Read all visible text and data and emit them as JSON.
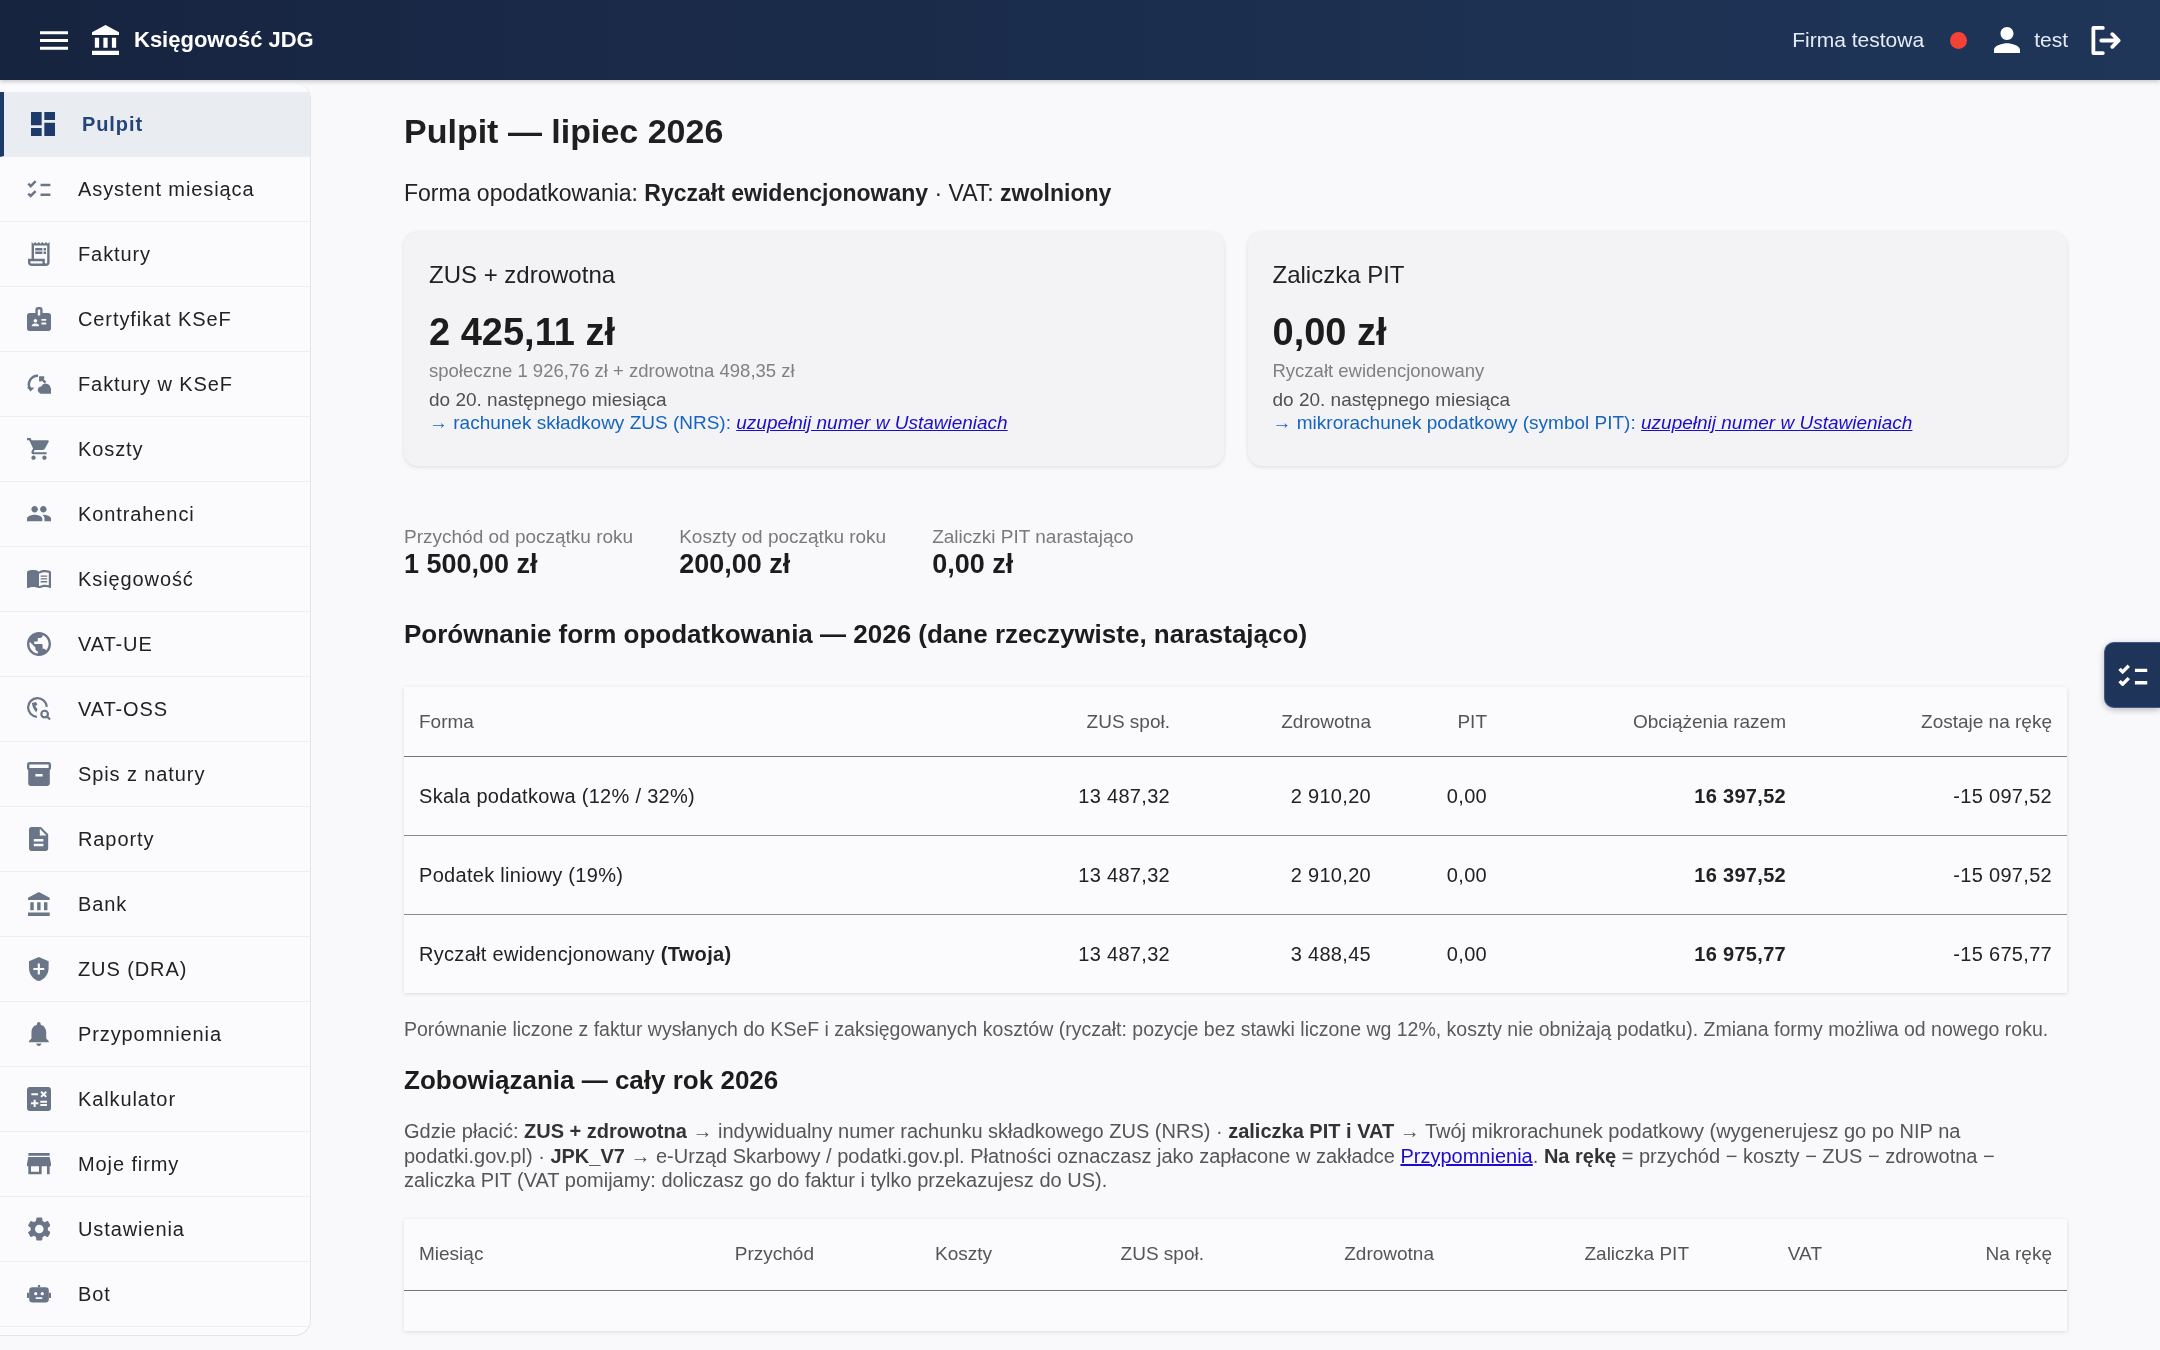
{
  "app_bar": {
    "title": "Księgowość JDG",
    "company": "Firma testowa",
    "user": "test"
  },
  "sidebar": {
    "items": [
      {
        "label": "Pulpit",
        "selected": true
      },
      {
        "label": "Asystent miesiąca",
        "selected": false
      },
      {
        "label": "Faktury",
        "selected": false
      },
      {
        "label": "Certyfikat KSeF",
        "selected": false
      },
      {
        "label": "Faktury w KSeF",
        "selected": false
      },
      {
        "label": "Koszty",
        "selected": false
      },
      {
        "label": "Kontrahenci",
        "selected": false
      },
      {
        "label": "Księgowość",
        "selected": false
      },
      {
        "label": "VAT-UE",
        "selected": false
      },
      {
        "label": "VAT-OSS",
        "selected": false
      },
      {
        "label": "Spis z natury",
        "selected": false
      },
      {
        "label": "Raporty",
        "selected": false
      },
      {
        "label": "Bank",
        "selected": false
      },
      {
        "label": "ZUS (DRA)",
        "selected": false
      },
      {
        "label": "Przypomnienia",
        "selected": false
      },
      {
        "label": "Kalkulator",
        "selected": false
      },
      {
        "label": "Moje firmy",
        "selected": false
      },
      {
        "label": "Ustawienia",
        "selected": false
      },
      {
        "label": "Bot",
        "selected": false
      }
    ]
  },
  "page": {
    "title": "Pulpit — lipiec 2026",
    "tax_summary": "Forma opodatkowania: **Ryczałt ewidencjonowany** · VAT: **zwolniony**"
  },
  "cards": [
    {
      "title": "ZUS + zdrowotna",
      "amount": "2 425,11 zł",
      "detail": "społeczne 1 926,76 zł + zdrowotna 498,35 zł",
      "due": "do 20. następnego miesiąca",
      "account_label": "→ rachunek składkowy ZUS (NRS):",
      "account_link": "uzupełnij numer w Ustawieniach"
    },
    {
      "title": "Zaliczka PIT",
      "amount": "0,00 zł",
      "detail": "Ryczałt ewidencjonowany",
      "due": "do 20. następnego miesiąca",
      "account_label": "→ mikrorachunek podatkowy (symbol PIT):",
      "account_link": "uzupełnij numer w Ustawieniach"
    }
  ],
  "stats": [
    {
      "label": "Przychód od początku roku",
      "value": "1 500,00 zł"
    },
    {
      "label": "Koszty od początku roku",
      "value": "200,00 zł"
    },
    {
      "label": "Zaliczki PIT narastająco",
      "value": "0,00 zł"
    }
  ],
  "comparison": {
    "heading": "Porównanie form opodatkowania — 2026 (dane rzeczywiste, narastająco)",
    "columns": [
      "Forma",
      "ZUS społ.",
      "Zdrowotna",
      "PIT",
      "Obciążenia razem",
      "Zostaje na rękę"
    ],
    "rows": [
      [
        "Skala podatkowa (12% / 32%)",
        "13 487,32",
        "2 910,20",
        "0,00",
        "16 397,52",
        "-15 097,52"
      ],
      [
        "Podatek liniowy (19%)",
        "13 487,32",
        "2 910,20",
        "0,00",
        "16 397,52",
        "-15 097,52"
      ],
      [
        "Ryczałt ewidencjonowany **(Twoja)**",
        "13 487,32",
        "3 488,45",
        "0,00",
        "16 975,77",
        "-15 675,77"
      ]
    ],
    "note": "Porównanie liczone z faktur wysłanych do KSeF i zaksięgowanych kosztów (ryczałt: pozycje bez stawki liczone wg 12%, koszty nie obniżają podatku). Zmiana formy możliwa od nowego roku."
  },
  "obligations": {
    "heading": "Zobowiązania — cały rok 2026",
    "info": {
      "before": "Gdzie płacić: **ZUS + zdrowotna** → indywidualny numer rachunku składkowego ZUS (NRS) · **zaliczka PIT i VAT** → Twój mikrorachunek podatkowy (wygenerujesz go po NIP na podatki.gov.pl) · **JPK_V7** → e-Urząd Skarbowy / podatki.gov.pl. Płatności oznaczasz jako zapłacone w zakładce",
      "link": "Przypomnienia",
      "after": ". **Na rękę** = przychód − koszty − ZUS − zdrowotna − zaliczka PIT (VAT pomijamy: doliczasz go do faktur i tylko przekazujesz do US)."
    },
    "columns": [
      "Miesiąc",
      "Przychód",
      "Koszty",
      "ZUS społ.",
      "Zdrowotna",
      "Zaliczka PIT",
      "VAT",
      "Na rękę"
    ]
  }
}
